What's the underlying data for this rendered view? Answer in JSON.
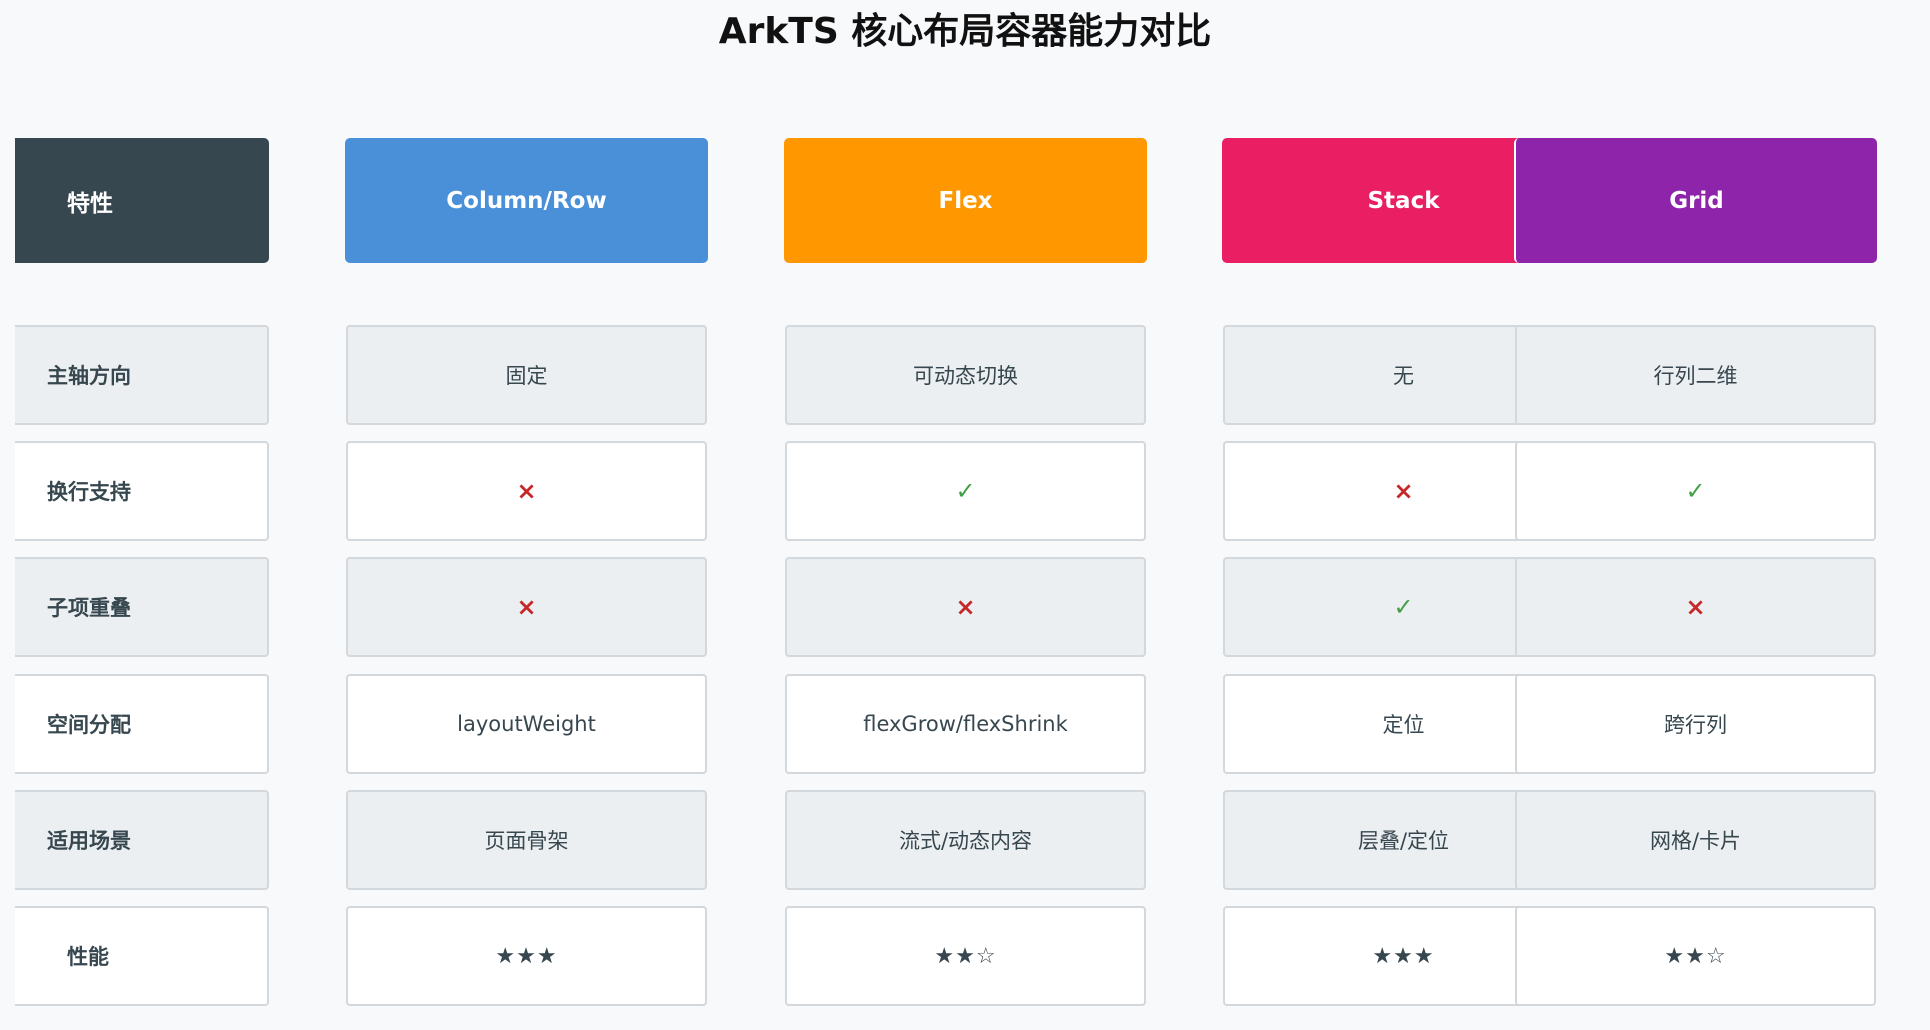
{
  "title": "ArkTS 核心布局容器能力对比",
  "colors": {
    "label_header": "#37474f",
    "column_row": "#4a90d9",
    "flex": "#ff9800",
    "stack": "#e91e63",
    "grid": "#8e24aa",
    "yes": "#43a047",
    "no": "#c62828"
  },
  "headers": [
    "特性",
    "Column/Row",
    "Flex",
    "Stack",
    "Grid"
  ],
  "rows": [
    {
      "label": "主轴方向",
      "values": [
        "固定",
        "可动态切换",
        "无",
        "行列二维"
      ]
    },
    {
      "label": "换行支持",
      "values": [
        "×",
        "✓",
        "×",
        "✓"
      ]
    },
    {
      "label": "子项重叠",
      "values": [
        "×",
        "×",
        "✓",
        "×"
      ]
    },
    {
      "label": "空间分配",
      "values": [
        "layoutWeight",
        "flexGrow/flexShrink",
        "定位",
        "跨行列"
      ]
    },
    {
      "label": "适用场景",
      "values": [
        "页面骨架",
        "流式/动态内容",
        "层叠/定位",
        "网格/卡片"
      ]
    },
    {
      "label": "性能",
      "values": [
        "★★★",
        "★★☆",
        "★★★",
        "★★☆"
      ]
    }
  ]
}
